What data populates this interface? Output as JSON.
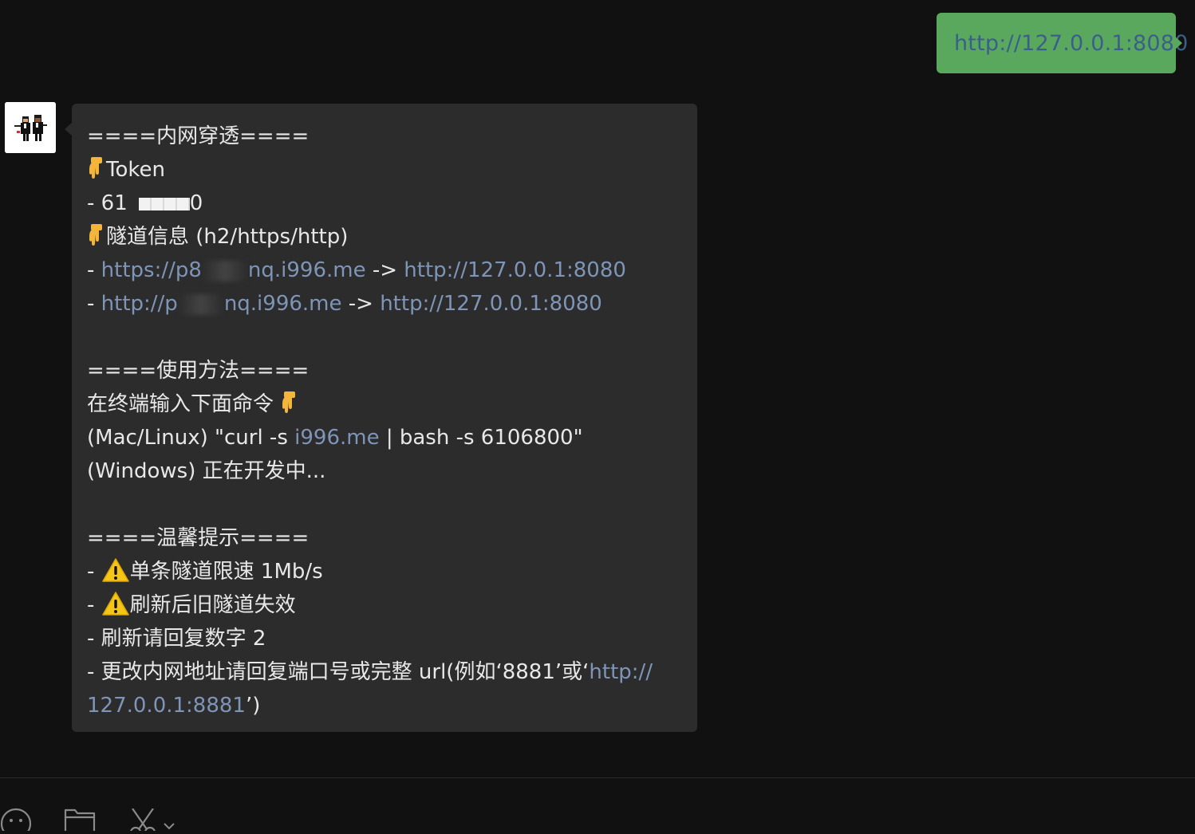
{
  "chat": {
    "outgoing": {
      "text": "http://127.0.0.1:8080"
    },
    "incoming": {
      "lines": {
        "l1": "====内网穿透====",
        "l2": "Token",
        "l3a": "- 61",
        "l3b": "0",
        "l4": "隧道信息 (h2/https/http)",
        "l5_prefix": "- ",
        "l5_link1a": "https://p8",
        "l5_link1b": "nq.i996.me",
        "l5_arrow": " -> ",
        "l5_link2": "http://127.0.0.1:8080",
        "l6_prefix": "- ",
        "l6_link1a": "http://p",
        "l6_link1b": "nq.i996.me",
        "l6_arrow": " -> ",
        "l6_link2": "http://127.0.0.1:8080",
        "l8": "====使用方法====",
        "l9": "在终端输入下面命令 ",
        "l10a": "(Mac/Linux) \"curl -s ",
        "l10_link": "i996.me",
        "l10b": " | bash -s 6106800\"",
        "l11": "(Windows) 正在开发中...",
        "l13": "====温馨提示====",
        "l14_prefix": "- ",
        "l14": "单条隧道限速 1Mb/s",
        "l15_prefix": "- ",
        "l15": "刷新后旧隧道失效",
        "l16": "- 刷新请回复数字 2",
        "l17a": "- 更改内网地址请回复端口号或完整 url(例如‘8881’或‘",
        "l17_link": "http://",
        "l18_link": "127.0.0.1:8881",
        "l18b": "’)"
      }
    }
  },
  "colors": {
    "background": "#111111",
    "outgoing_bubble": "#5aa85e",
    "incoming_bubble": "#2c2c2c",
    "link": "#7e95b8"
  },
  "toolbar": {
    "icons": [
      "emoji-icon",
      "folder-icon",
      "scissors-icon",
      "chevron-down-icon"
    ]
  }
}
